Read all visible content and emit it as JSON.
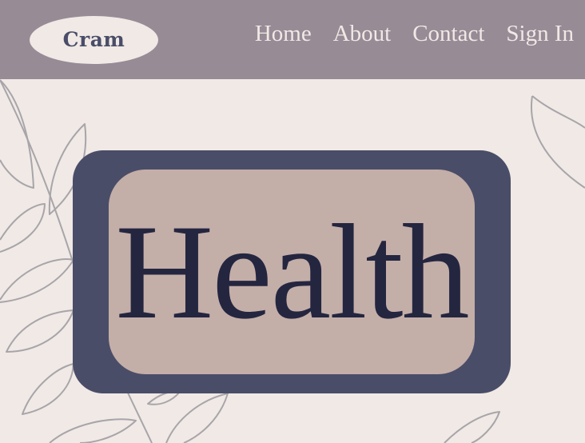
{
  "header": {
    "logo_text": "Cram",
    "nav": [
      {
        "label": "Home"
      },
      {
        "label": "About"
      },
      {
        "label": "Contact"
      },
      {
        "label": "Sign In"
      }
    ]
  },
  "hero": {
    "title": "Health"
  },
  "colors": {
    "background": "#f0e9e5",
    "header": "#978b96",
    "frame": "#4a4d68",
    "card": "#c4aea8",
    "title_text": "#242640",
    "leaf_outline": "#a8a5aa"
  }
}
